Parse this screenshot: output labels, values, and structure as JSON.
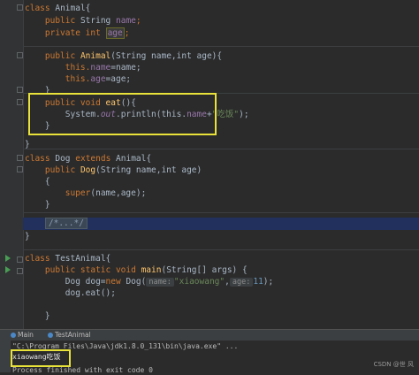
{
  "code": {
    "l1_kw": "class",
    "l1_name": "Animal{",
    "l2_kw": "public",
    "l2_type": "String",
    "l2_field": "name",
    "l2_end": ";",
    "l3_kw": "private",
    "l3_type": "int",
    "l3_field": "age",
    "l3_end": ";",
    "l5_kw": "public",
    "l5_fn": "Animal",
    "l5_rest": "(String name,int age){",
    "l6_this": "this.",
    "l6_field": "name",
    "l6_rest": "=name;",
    "l7_this": "this.",
    "l7_field": "age",
    "l7_rest": "=age;",
    "l8": "}",
    "l10_kw": "public void",
    "l10_fn": "eat",
    "l10_rest": "(){",
    "l11_a": "System.",
    "l11_out": "out",
    "l11_b": ".println(this.",
    "l11_field": "name",
    "l11_c": "+",
    "l11_str": "\"吃饭\"",
    "l11_d": ");",
    "l12": "}",
    "l14": "}",
    "l15_kw": "class",
    "l15_name": "Dog",
    "l15_ext": "extends",
    "l15_rest": "Animal{",
    "l16_kw": "public",
    "l16_fn": "Dog",
    "l16_rest": "(String name,int age)",
    "l17": "{",
    "l18_kw": "super",
    "l18_rest": "(name,age);",
    "l19": "}",
    "l21": "/*...*/",
    "l22": "}",
    "l23_kw": "class",
    "l23_name": "TestAnimal{",
    "l24_kw": "public static void",
    "l24_fn": "main",
    "l24_rest": "(String[] args) {",
    "l25_a": "Dog dog=",
    "l25_new": "new",
    "l25_b": "Dog(",
    "l25_hint1": "name:",
    "l25_str": "\"xiaowang\"",
    "l25_c": ",",
    "l25_hint2": "age:",
    "l25_num": "11",
    "l25_d": ");",
    "l26": "dog.eat();",
    "l28": "}"
  },
  "tabs": {
    "main": "Main",
    "test": "TestAnimal"
  },
  "console": {
    "cmd": "\"C:\\Program Files\\Java\\jdk1.8.0_131\\bin\\java.exe\" ...",
    "output": "xiaowang吃饭",
    "exit": "Process finished with exit code 0"
  },
  "watermark": "CSDN @世 风"
}
